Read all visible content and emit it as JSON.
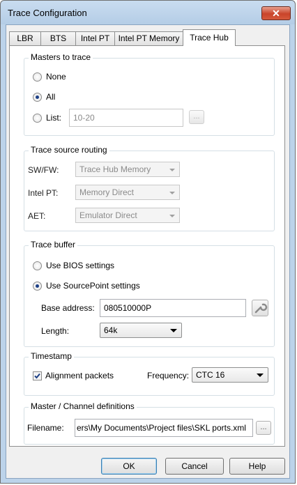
{
  "window": {
    "title": "Trace Configuration",
    "close_label": "✕"
  },
  "tabs": [
    {
      "label": "LBR"
    },
    {
      "label": "BTS"
    },
    {
      "label": "Intel PT"
    },
    {
      "label": "Intel PT Memory"
    },
    {
      "label": "Trace Hub",
      "selected": true
    }
  ],
  "masters": {
    "title": "Masters to trace",
    "options": [
      {
        "label": "None",
        "selected": false
      },
      {
        "label": "All",
        "selected": true
      },
      {
        "label": "List:",
        "selected": false
      }
    ],
    "list_value": "10-20",
    "browse_label": "..."
  },
  "routing": {
    "title": "Trace source routing",
    "rows": [
      {
        "label": "SW/FW:",
        "value": "Trace Hub Memory"
      },
      {
        "label": "Intel PT:",
        "value": "Memory Direct"
      },
      {
        "label": "AET:",
        "value": "Emulator Direct"
      }
    ]
  },
  "buffer": {
    "title": "Trace buffer",
    "options": [
      {
        "label": "Use BIOS settings",
        "selected": false
      },
      {
        "label": "Use SourcePoint settings",
        "selected": true
      }
    ],
    "base_address_label": "Base address:",
    "base_address_value": "080510000P",
    "length_label": "Length:",
    "length_value": "64k"
  },
  "timestamp": {
    "title": "Timestamp",
    "alignment_label": "Alignment packets",
    "alignment_checked": true,
    "frequency_label": "Frequency:",
    "frequency_value": "CTC 16"
  },
  "definitions": {
    "title": "Master / Channel definitions",
    "filename_label": "Filename:",
    "filename_value": "ers\\My Documents\\Project files\\SKL ports.xml",
    "browse_label": "..."
  },
  "buttons": {
    "ok": "OK",
    "cancel": "Cancel",
    "help": "Help"
  },
  "colors": {
    "accent": "#1c3f86",
    "close_button": "#c9442a",
    "title_bar": "#bcd3ea"
  }
}
